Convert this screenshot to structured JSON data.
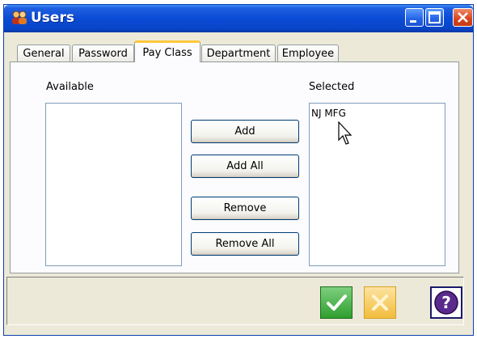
{
  "window": {
    "title": "Users",
    "app_icon": "users-icon",
    "controls": [
      "minimize-icon",
      "maximize-icon",
      "close-icon"
    ]
  },
  "tabs": [
    {
      "label": "General",
      "active": false
    },
    {
      "label": "Password",
      "active": false
    },
    {
      "label": "Pay Class",
      "active": true
    },
    {
      "label": "Department",
      "active": false
    },
    {
      "label": "Employee",
      "active": false
    }
  ],
  "pay_class": {
    "available_label": "Available",
    "selected_label": "Selected",
    "available_items": [],
    "selected_items": [
      "NJ MFG"
    ],
    "buttons": {
      "add": "Add",
      "add_all": "Add All",
      "remove": "Remove",
      "remove_all": "Remove All"
    }
  },
  "footer": {
    "ok_icon": "checkmark-icon",
    "cancel_icon": "cancel-x-icon",
    "help_icon": "help-question-icon"
  },
  "colors": {
    "titlebar": "#0a4bd6",
    "tab_highlight": "#ffc83c",
    "ok_green": "#3cb43c",
    "cancel_yellow": "#f5c842",
    "help_purple": "#5a2a8c"
  }
}
